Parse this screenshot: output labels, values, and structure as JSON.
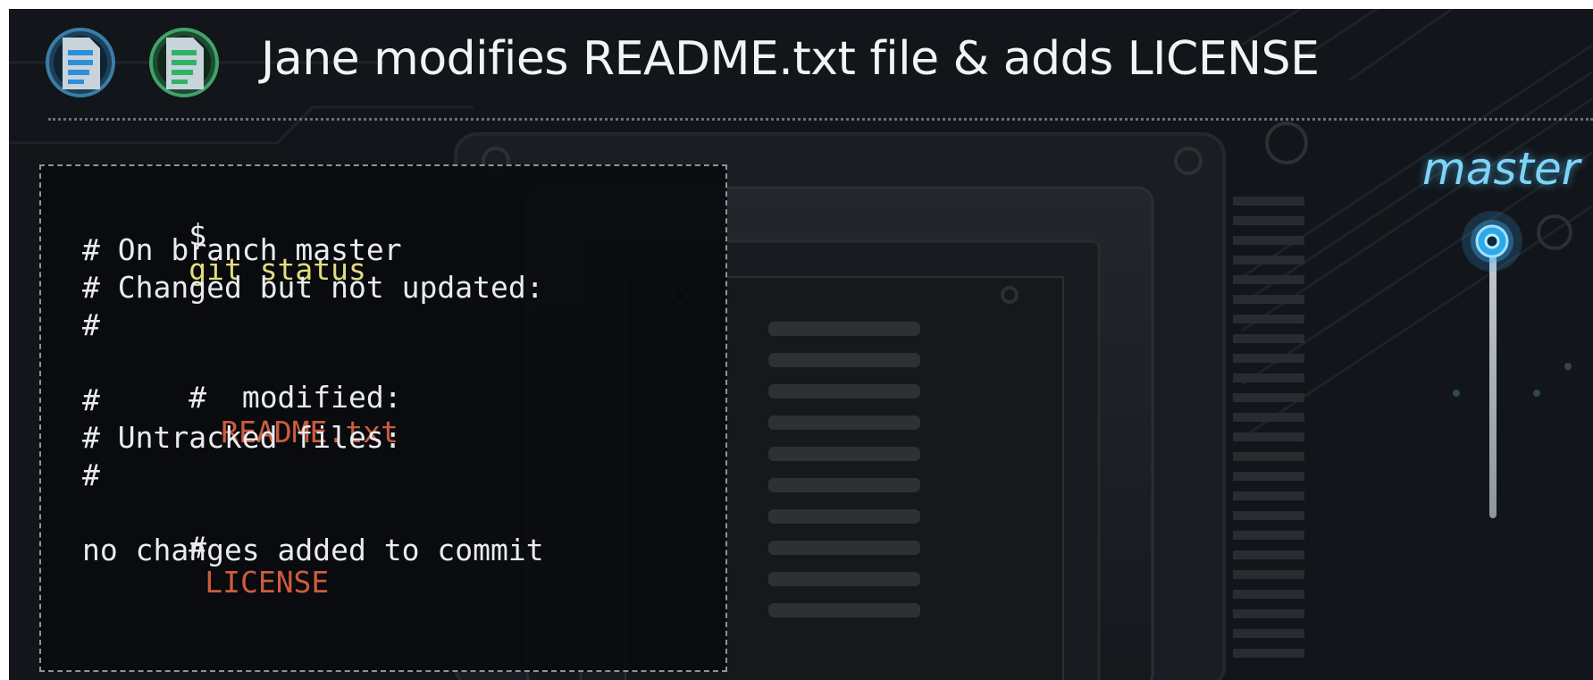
{
  "slide": {
    "title": "Jane modifies README.txt file & adds LICENSE",
    "icons": [
      "blue-document-icon",
      "green-document-icon"
    ],
    "colors": {
      "background": "#121519",
      "command": "#e2dd7c",
      "filename": "#cf5b3f",
      "branch": "#7fd4f5"
    }
  },
  "terminal": {
    "prompt": "$",
    "command": "git status",
    "lines": {
      "on_branch": "# On branch master",
      "changed_header": "# Changed but not updated:",
      "hash_1": "#",
      "modified_prefix": "#  modified:",
      "modified_file": "README.txt",
      "hash_2": "#",
      "untracked_header": "# Untracked files:",
      "hash_3": "#",
      "untracked_prefix": "#",
      "untracked_file": "LICENSE",
      "summary": "no changes added to commit"
    }
  },
  "branch": {
    "label": "master"
  }
}
